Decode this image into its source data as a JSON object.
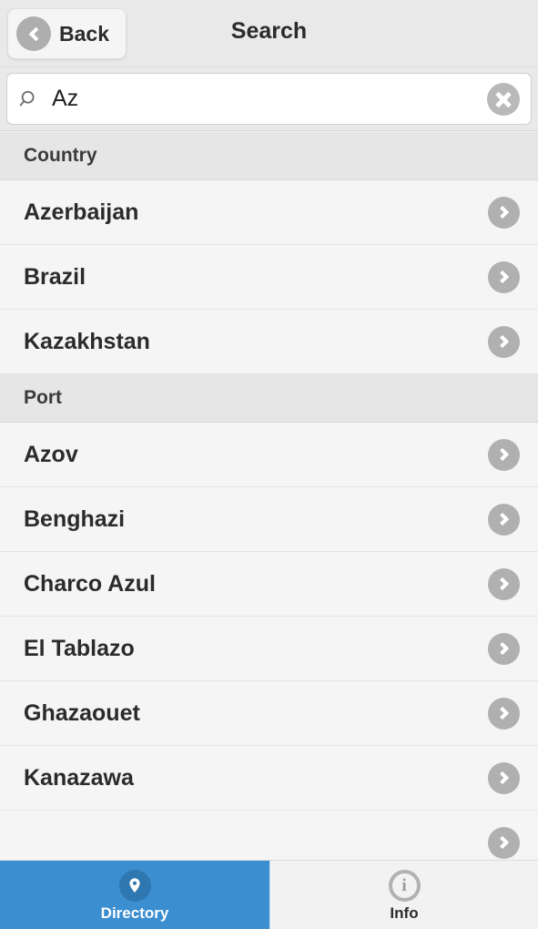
{
  "header": {
    "back_label": "Back",
    "back_icon": "chevron-left-icon",
    "title": "Search"
  },
  "search": {
    "value": "Az",
    "placeholder": "Search",
    "search_icon": "search-icon",
    "clear_icon": "clear-circle-icon"
  },
  "list": {
    "sections": [
      {
        "header": "Country",
        "rows": [
          {
            "label": "Azerbaijan",
            "accessory": "chevron-right-icon"
          },
          {
            "label": "Brazil",
            "accessory": "chevron-right-icon"
          },
          {
            "label": "Kazakhstan",
            "accessory": "chevron-right-icon"
          }
        ]
      },
      {
        "header": "Port",
        "rows": [
          {
            "label": "Azov",
            "accessory": "chevron-right-icon"
          },
          {
            "label": "Benghazi",
            "accessory": "chevron-right-icon"
          },
          {
            "label": "Charco Azul",
            "accessory": "chevron-right-icon"
          },
          {
            "label": "El Tablazo",
            "accessory": "chevron-right-icon"
          },
          {
            "label": "Ghazaouet",
            "accessory": "chevron-right-icon"
          },
          {
            "label": "Kanazawa",
            "accessory": "chevron-right-icon"
          },
          {
            "label": "",
            "accessory": "chevron-right-icon"
          }
        ]
      }
    ]
  },
  "tabbar": {
    "tabs": [
      {
        "label": "Directory",
        "icon": "map-pin-icon",
        "active": true
      },
      {
        "label": "Info",
        "icon": "info-circle-icon",
        "active": false
      }
    ]
  },
  "colors": {
    "accent_blue": "#3b8ed0",
    "pin_badge_blue": "#2f77b0",
    "chrome_gray": "#e9e9e9",
    "row_gray": "#f5f5f5",
    "section_gray": "#e6e6e6",
    "icon_gray": "#b0b0b0",
    "text_dark": "#2b2b2b"
  }
}
